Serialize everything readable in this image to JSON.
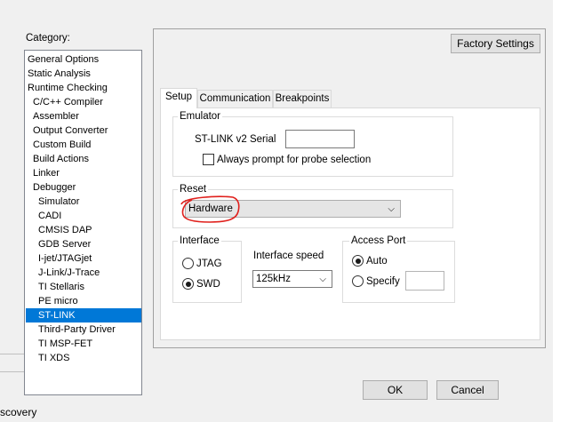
{
  "category": {
    "label": "Category:",
    "items": [
      {
        "label": "General Options",
        "indent": 0
      },
      {
        "label": "Static Analysis",
        "indent": 0
      },
      {
        "label": "Runtime Checking",
        "indent": 0
      },
      {
        "label": "C/C++ Compiler",
        "indent": 1
      },
      {
        "label": "Assembler",
        "indent": 1
      },
      {
        "label": "Output Converter",
        "indent": 1
      },
      {
        "label": "Custom Build",
        "indent": 1
      },
      {
        "label": "Build Actions",
        "indent": 1
      },
      {
        "label": "Linker",
        "indent": 1
      },
      {
        "label": "Debugger",
        "indent": 1
      },
      {
        "label": "Simulator",
        "indent": 2
      },
      {
        "label": "CADI",
        "indent": 2
      },
      {
        "label": "CMSIS DAP",
        "indent": 2
      },
      {
        "label": "GDB Server",
        "indent": 2
      },
      {
        "label": "I-jet/JTAGjet",
        "indent": 2
      },
      {
        "label": "J-Link/J-Trace",
        "indent": 2
      },
      {
        "label": "TI Stellaris",
        "indent": 2
      },
      {
        "label": "PE micro",
        "indent": 2
      },
      {
        "label": "ST-LINK",
        "indent": 2,
        "selected": true
      },
      {
        "label": "Third-Party Driver",
        "indent": 2
      },
      {
        "label": "TI MSP-FET",
        "indent": 2
      },
      {
        "label": "TI XDS",
        "indent": 2
      }
    ]
  },
  "factory_settings_label": "Factory Settings",
  "tabs": [
    {
      "label": "Setup",
      "active": true
    },
    {
      "label": "Communication",
      "active": false
    },
    {
      "label": "Breakpoints",
      "active": false
    }
  ],
  "emulator": {
    "title": "Emulator",
    "serial_label": "ST-LINK v2  Serial",
    "serial_value": "",
    "always_prompt_label": "Always prompt for probe selection",
    "always_prompt_checked": false
  },
  "reset": {
    "title": "Reset",
    "value": "Hardware"
  },
  "interface": {
    "title": "Interface",
    "options": [
      {
        "label": "JTAG",
        "selected": false
      },
      {
        "label": "SWD",
        "selected": true
      }
    ]
  },
  "interface_speed": {
    "label": "Interface speed",
    "value": "125kHz"
  },
  "access_port": {
    "title": "Access Port",
    "auto_label": "Auto",
    "auto_selected": true,
    "specify_label": "Specify",
    "specify_selected": false,
    "specify_value": ""
  },
  "ok_label": "OK",
  "cancel_label": "Cancel",
  "behind_text": "scovery",
  "colors": {
    "selection": "#0078d7",
    "annotation_red": "#e0201c"
  }
}
